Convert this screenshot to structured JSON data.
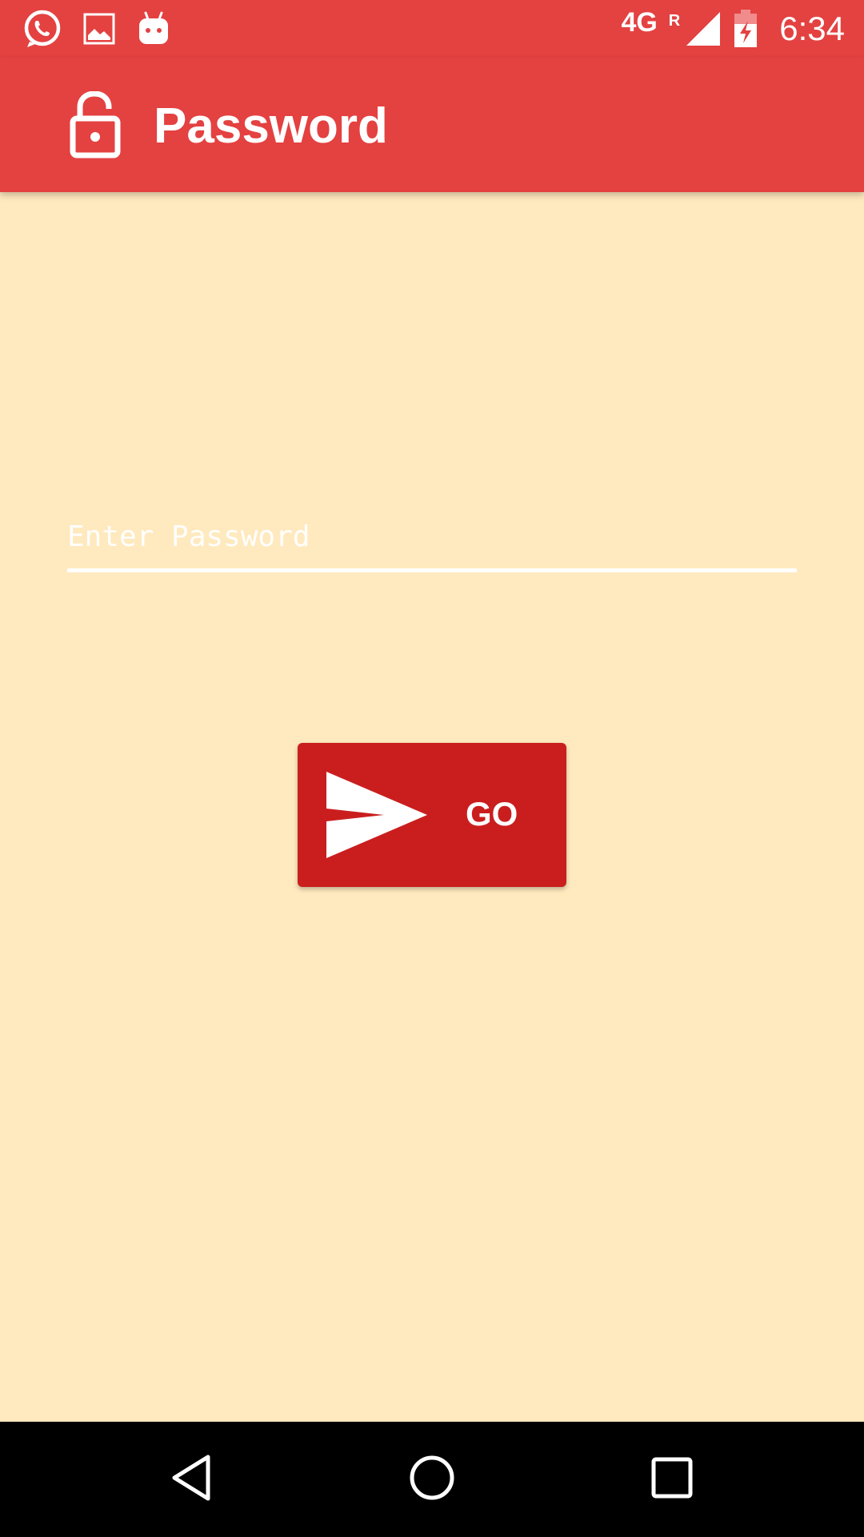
{
  "status_bar": {
    "network_type": "4G",
    "roaming_indicator": "R",
    "time": "6:34",
    "icons": [
      "whatsapp-icon",
      "image-icon",
      "android-icon",
      "signal-icon",
      "battery-charging-icon"
    ]
  },
  "app_bar": {
    "title": "Password",
    "icon": "lock-open-icon"
  },
  "form": {
    "password_placeholder": "Enter Password",
    "password_value": "",
    "go_button_label": "GO",
    "go_button_icon": "send-icon"
  },
  "nav_bar": {
    "icons": [
      "back-icon",
      "home-icon",
      "recents-icon"
    ]
  },
  "colors": {
    "primary": "#E44141",
    "button": "#CA1E1E",
    "background": "#FFE9BE",
    "nav_bar": "#000000"
  }
}
